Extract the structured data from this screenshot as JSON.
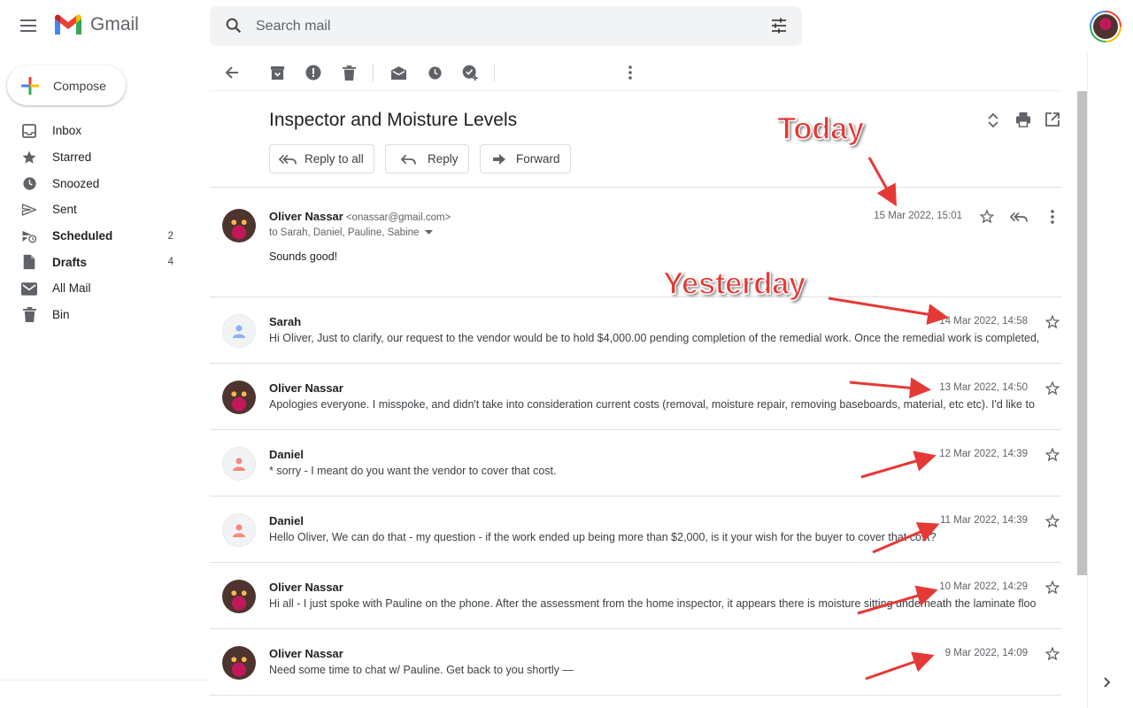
{
  "app": {
    "name": "Gmail"
  },
  "search": {
    "placeholder": "Search mail"
  },
  "sidebar": {
    "compose_label": "Compose",
    "items": [
      {
        "label": "Inbox",
        "count": "",
        "bold": false,
        "icon": "inbox-icon"
      },
      {
        "label": "Starred",
        "count": "",
        "bold": false,
        "icon": "star-icon"
      },
      {
        "label": "Snoozed",
        "count": "",
        "bold": false,
        "icon": "clock-icon"
      },
      {
        "label": "Sent",
        "count": "",
        "bold": false,
        "icon": "send-icon"
      },
      {
        "label": "Scheduled",
        "count": "2",
        "bold": true,
        "icon": "scheduled-send-icon"
      },
      {
        "label": "Drafts",
        "count": "4",
        "bold": true,
        "icon": "draft-icon"
      },
      {
        "label": "All Mail",
        "count": "",
        "bold": false,
        "icon": "mail-icon"
      },
      {
        "label": "Bin",
        "count": "",
        "bold": false,
        "icon": "trash-icon"
      }
    ]
  },
  "thread": {
    "subject": "Inspector and Moisture Levels",
    "actions": {
      "reply_all": "Reply to all",
      "reply": "Reply",
      "forward": "Forward"
    },
    "expanded": {
      "sender": "Oliver Nassar",
      "email": "<onassar@gmail.com>",
      "to": "to Sarah, Daniel, Pauline, Sabine",
      "date": "15 Mar 2022, 15:01",
      "body": "Sounds good!"
    },
    "messages": [
      {
        "sender": "Sarah",
        "date": "14 Mar 2022, 14:58",
        "snippet": "Hi Oliver, Just to clarify, our request to the vendor would be to hold $4,000.00 pending completion of the remedial work. Once the remedial work is completed, t"
      },
      {
        "sender": "Oliver Nassar",
        "date": "13 Mar 2022, 14:50",
        "snippet": "Apologies everyone. I misspoke, and didn't take into consideration current costs (removal, moisture repair, removing baseboards, material, etc etc). I'd like to"
      },
      {
        "sender": "Daniel",
        "date": "12 Mar 2022, 14:39",
        "snippet": "* sorry - I meant do you want the vendor to cover that cost."
      },
      {
        "sender": "Daniel",
        "date": "11 Mar 2022, 14:39",
        "snippet": "Hello Oliver, We can do that - my question - if the work ended up being more than $2,000, is it your wish for the buyer to cover that cost?"
      },
      {
        "sender": "Oliver Nassar",
        "date": "10 Mar 2022, 14:29",
        "snippet": "Hi all - I just spoke with Pauline on the phone. After the assessment from the home inspector, it appears there is moisture sitting underneath the laminate floo"
      },
      {
        "sender": "Oliver Nassar",
        "date": "9 Mar 2022, 14:09",
        "snippet": "Need some time to chat w/ Pauline. Get back to you shortly —"
      }
    ]
  },
  "annotations": {
    "today": "Today",
    "yesterday": "Yesterday"
  },
  "colors": {
    "annotation": "#e53935",
    "scrollbar": "#c1c1c1",
    "search_bg": "#f1f3f4"
  }
}
